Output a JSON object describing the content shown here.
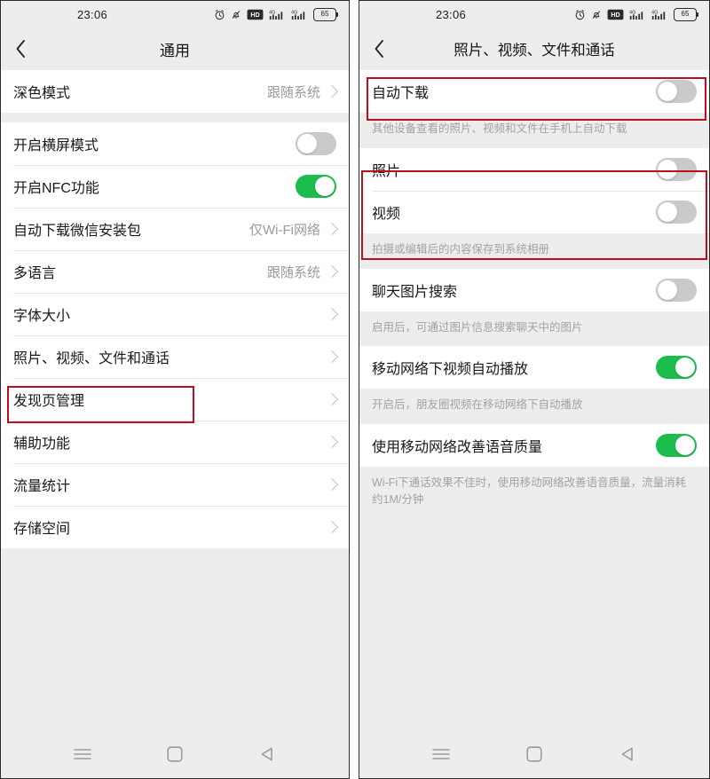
{
  "colors": {
    "accent_green": "#1bbd4c",
    "annotation_red": "#c00d1e",
    "toggle_off": "#c9cacc",
    "page_bg": "#ededed"
  },
  "status_bar": {
    "time": "23:06",
    "battery_level": "65",
    "hd_label": "HD",
    "network_label": "4G",
    "icons": [
      "alarm-icon",
      "bell-muted-icon",
      "hd-icon",
      "signal-1-icon",
      "signal-2-icon",
      "battery-icon"
    ]
  },
  "android_nav": {
    "recents_label": "recents",
    "home_label": "home",
    "back_label": "back"
  },
  "left_screen": {
    "title": "通用",
    "back_label": "返回",
    "groups": [
      {
        "rows": [
          {
            "label": "深色模式",
            "type": "value",
            "value": "跟随系统"
          }
        ]
      },
      {
        "rows": [
          {
            "label": "开启横屏模式",
            "type": "toggle",
            "on": false
          },
          {
            "label": "开启NFC功能",
            "type": "toggle",
            "on": true
          },
          {
            "label": "自动下载微信安装包",
            "type": "value",
            "value": "仅Wi-Fi网络"
          },
          {
            "label": "多语言",
            "type": "value",
            "value": "跟随系统"
          },
          {
            "label": "字体大小",
            "type": "link",
            "value": ""
          },
          {
            "label": "照片、视频、文件和通话",
            "type": "link",
            "value": "",
            "highlighted": true
          },
          {
            "label": "发现页管理",
            "type": "link",
            "value": ""
          },
          {
            "label": "辅助功能",
            "type": "link",
            "value": ""
          },
          {
            "label": "流量统计",
            "type": "link",
            "value": ""
          },
          {
            "label": "存储空间",
            "type": "link",
            "value": ""
          }
        ]
      }
    ]
  },
  "right_screen": {
    "title": "照片、视频、文件和通话",
    "back_label": "返回",
    "sections": [
      {
        "rows": [
          {
            "label": "自动下载",
            "type": "toggle",
            "on": false
          }
        ],
        "note": "其他设备查看的照片、视频和文件在手机上自动下载",
        "highlighted": true
      },
      {
        "rows": [
          {
            "label": "照片",
            "type": "toggle",
            "on": false
          },
          {
            "label": "视频",
            "type": "toggle",
            "on": false
          }
        ],
        "note": "拍摄或编辑后的内容保存到系统相册",
        "highlighted": true
      },
      {
        "rows": [
          {
            "label": "聊天图片搜索",
            "type": "toggle",
            "on": false
          }
        ],
        "note": "启用后，可通过图片信息搜索聊天中的图片",
        "highlighted": false
      },
      {
        "rows": [
          {
            "label": "移动网络下视频自动播放",
            "type": "toggle",
            "on": true
          }
        ],
        "note": "开启后，朋友圈视频在移动网络下自动播放",
        "highlighted": false
      },
      {
        "rows": [
          {
            "label": "使用移动网络改善语音质量",
            "type": "toggle",
            "on": true
          }
        ],
        "note": "Wi-Fi下通话效果不佳时，使用移动网络改善语音质量，流量消耗约1M/分钟",
        "highlighted": false
      }
    ]
  }
}
